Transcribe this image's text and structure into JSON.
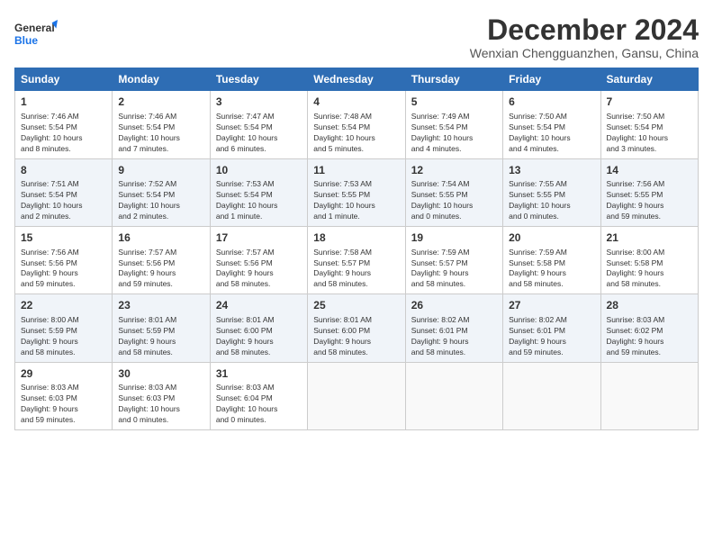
{
  "logo": {
    "line1": "General",
    "line2": "Blue"
  },
  "title": "December 2024",
  "subtitle": "Wenxian Chengguanzhen, Gansu, China",
  "headers": [
    "Sunday",
    "Monday",
    "Tuesday",
    "Wednesday",
    "Thursday",
    "Friday",
    "Saturday"
  ],
  "weeks": [
    [
      {
        "day": "1",
        "info": "Sunrise: 7:46 AM\nSunset: 5:54 PM\nDaylight: 10 hours\nand 8 minutes."
      },
      {
        "day": "2",
        "info": "Sunrise: 7:46 AM\nSunset: 5:54 PM\nDaylight: 10 hours\nand 7 minutes."
      },
      {
        "day": "3",
        "info": "Sunrise: 7:47 AM\nSunset: 5:54 PM\nDaylight: 10 hours\nand 6 minutes."
      },
      {
        "day": "4",
        "info": "Sunrise: 7:48 AM\nSunset: 5:54 PM\nDaylight: 10 hours\nand 5 minutes."
      },
      {
        "day": "5",
        "info": "Sunrise: 7:49 AM\nSunset: 5:54 PM\nDaylight: 10 hours\nand 4 minutes."
      },
      {
        "day": "6",
        "info": "Sunrise: 7:50 AM\nSunset: 5:54 PM\nDaylight: 10 hours\nand 4 minutes."
      },
      {
        "day": "7",
        "info": "Sunrise: 7:50 AM\nSunset: 5:54 PM\nDaylight: 10 hours\nand 3 minutes."
      }
    ],
    [
      {
        "day": "8",
        "info": "Sunrise: 7:51 AM\nSunset: 5:54 PM\nDaylight: 10 hours\nand 2 minutes."
      },
      {
        "day": "9",
        "info": "Sunrise: 7:52 AM\nSunset: 5:54 PM\nDaylight: 10 hours\nand 2 minutes."
      },
      {
        "day": "10",
        "info": "Sunrise: 7:53 AM\nSunset: 5:54 PM\nDaylight: 10 hours\nand 1 minute."
      },
      {
        "day": "11",
        "info": "Sunrise: 7:53 AM\nSunset: 5:55 PM\nDaylight: 10 hours\nand 1 minute."
      },
      {
        "day": "12",
        "info": "Sunrise: 7:54 AM\nSunset: 5:55 PM\nDaylight: 10 hours\nand 0 minutes."
      },
      {
        "day": "13",
        "info": "Sunrise: 7:55 AM\nSunset: 5:55 PM\nDaylight: 10 hours\nand 0 minutes."
      },
      {
        "day": "14",
        "info": "Sunrise: 7:56 AM\nSunset: 5:55 PM\nDaylight: 9 hours\nand 59 minutes."
      }
    ],
    [
      {
        "day": "15",
        "info": "Sunrise: 7:56 AM\nSunset: 5:56 PM\nDaylight: 9 hours\nand 59 minutes."
      },
      {
        "day": "16",
        "info": "Sunrise: 7:57 AM\nSunset: 5:56 PM\nDaylight: 9 hours\nand 59 minutes."
      },
      {
        "day": "17",
        "info": "Sunrise: 7:57 AM\nSunset: 5:56 PM\nDaylight: 9 hours\nand 58 minutes."
      },
      {
        "day": "18",
        "info": "Sunrise: 7:58 AM\nSunset: 5:57 PM\nDaylight: 9 hours\nand 58 minutes."
      },
      {
        "day": "19",
        "info": "Sunrise: 7:59 AM\nSunset: 5:57 PM\nDaylight: 9 hours\nand 58 minutes."
      },
      {
        "day": "20",
        "info": "Sunrise: 7:59 AM\nSunset: 5:58 PM\nDaylight: 9 hours\nand 58 minutes."
      },
      {
        "day": "21",
        "info": "Sunrise: 8:00 AM\nSunset: 5:58 PM\nDaylight: 9 hours\nand 58 minutes."
      }
    ],
    [
      {
        "day": "22",
        "info": "Sunrise: 8:00 AM\nSunset: 5:59 PM\nDaylight: 9 hours\nand 58 minutes."
      },
      {
        "day": "23",
        "info": "Sunrise: 8:01 AM\nSunset: 5:59 PM\nDaylight: 9 hours\nand 58 minutes."
      },
      {
        "day": "24",
        "info": "Sunrise: 8:01 AM\nSunset: 6:00 PM\nDaylight: 9 hours\nand 58 minutes."
      },
      {
        "day": "25",
        "info": "Sunrise: 8:01 AM\nSunset: 6:00 PM\nDaylight: 9 hours\nand 58 minutes."
      },
      {
        "day": "26",
        "info": "Sunrise: 8:02 AM\nSunset: 6:01 PM\nDaylight: 9 hours\nand 58 minutes."
      },
      {
        "day": "27",
        "info": "Sunrise: 8:02 AM\nSunset: 6:01 PM\nDaylight: 9 hours\nand 59 minutes."
      },
      {
        "day": "28",
        "info": "Sunrise: 8:03 AM\nSunset: 6:02 PM\nDaylight: 9 hours\nand 59 minutes."
      }
    ],
    [
      {
        "day": "29",
        "info": "Sunrise: 8:03 AM\nSunset: 6:03 PM\nDaylight: 9 hours\nand 59 minutes."
      },
      {
        "day": "30",
        "info": "Sunrise: 8:03 AM\nSunset: 6:03 PM\nDaylight: 10 hours\nand 0 minutes."
      },
      {
        "day": "31",
        "info": "Sunrise: 8:03 AM\nSunset: 6:04 PM\nDaylight: 10 hours\nand 0 minutes."
      },
      null,
      null,
      null,
      null
    ]
  ]
}
